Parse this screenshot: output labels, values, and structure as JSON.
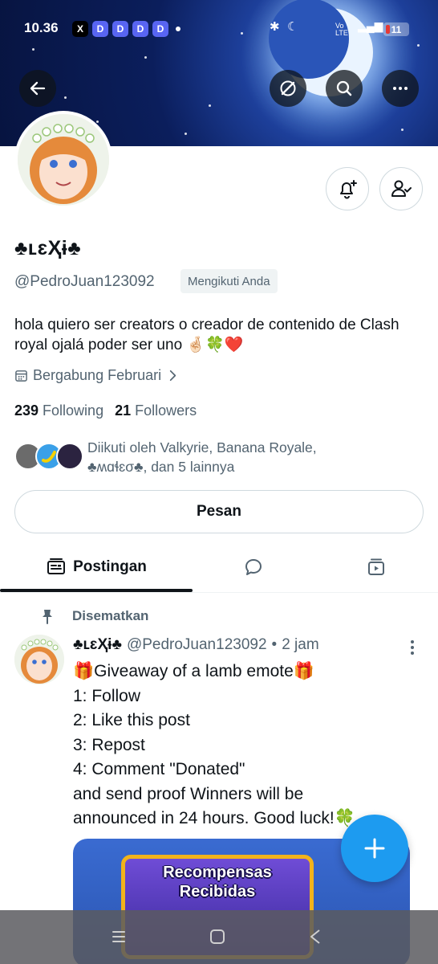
{
  "status_bar": {
    "time": "10.36",
    "x_app": "X",
    "discord_app": "D",
    "network": "Vo LTE",
    "battery": "11"
  },
  "header": {
    "back_icon": "arrow-left-icon",
    "grok_icon": "slash-circle-icon",
    "search_icon": "search-icon",
    "more_icon": "more-dots-icon"
  },
  "profile": {
    "display_name": "♣ʟɛҲɨ♣",
    "handle": "@PedroJuan123092",
    "follows_you": "Mengikuti Anda",
    "bio": "hola quiero ser creators o creador de contenido de Clash royal ojalá poder ser uno 🤞🏻🍀❤️",
    "joined": "Bergabung Februari",
    "following_count": "239",
    "following_label": "Following",
    "followers_count": "21",
    "followers_label": "Followers",
    "followed_by_line1": "Diikuti oleh Valkyrie, Banana Royale,",
    "followed_by_line2": "♣ʍɑɬɛσ♣, dan 5 lainnya",
    "message_button": "Pesan"
  },
  "tabs": [
    {
      "label": "Postingan",
      "icon": "posts-icon",
      "active": true
    },
    {
      "label": "",
      "icon": "replies-icon",
      "active": false
    },
    {
      "label": "",
      "icon": "media-icon",
      "active": false
    }
  ],
  "pinned_post": {
    "pinned_label": "Disematkan",
    "author_name": "♣ʟɛҲɨ♣",
    "author_handle": "@PedroJuan123092",
    "separator": "•",
    "time": "2 jam",
    "body_lines": [
      "🎁Giveaway of a lamb emote🎁",
      "1: Follow",
      "2: Like this post",
      "3: Repost",
      "4: Comment \"Donated\"",
      "and send proof Winners will be",
      "announced in 24 hours. Good luck!🍀"
    ],
    "media_text_line1": "Recompensas",
    "media_text_line2": "Recibidas"
  },
  "fab": {
    "icon": "plus-icon"
  },
  "colors": {
    "accent": "#1d9bf0",
    "text_primary": "#0f1419",
    "text_secondary": "#536471",
    "border": "#cfd9de"
  }
}
